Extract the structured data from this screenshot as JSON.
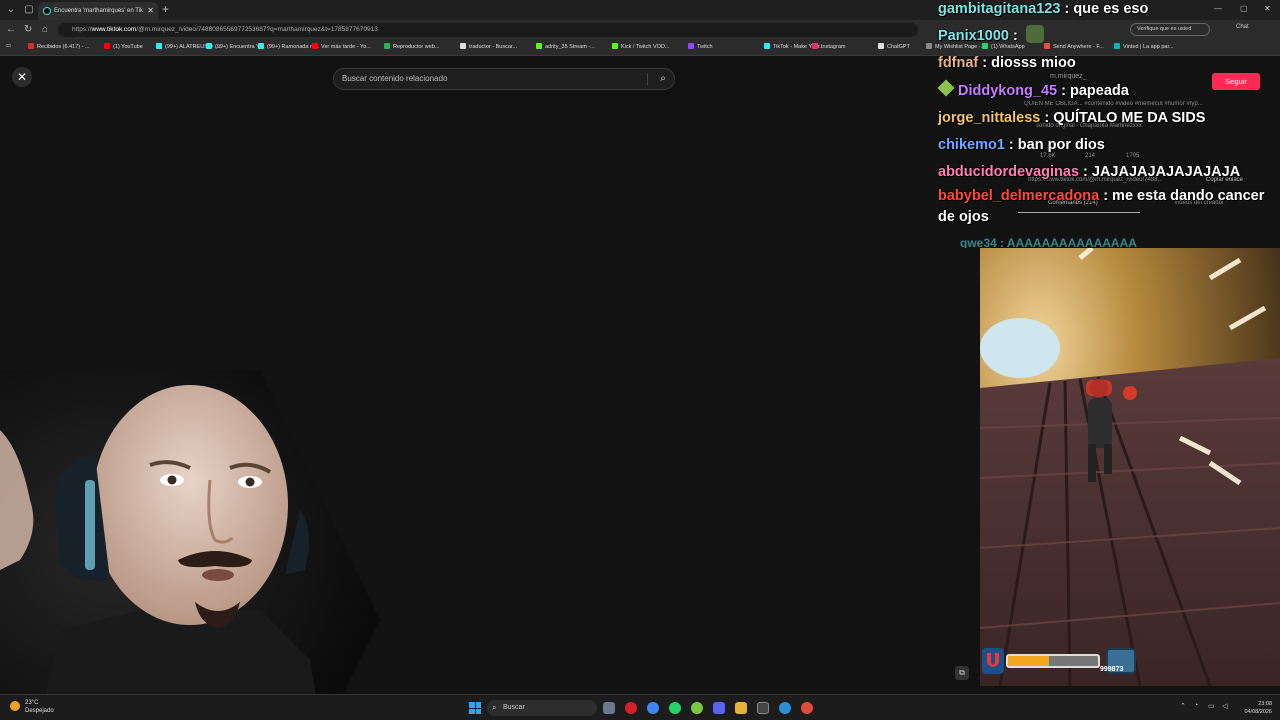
{
  "browser": {
    "tab_title": "Encuentra 'marthamirques' en Tik",
    "url_prefix": "https://",
    "url_host": "www.tiktok.com",
    "url_path": "/@m.mirquez_/video/7488086556977253687?q=marthamirquez&t=1785877670913",
    "verify_label": "Verifique que es usted",
    "chat_label": "Chat",
    "bookmarks": [
      {
        "label": "Recibidos (6.417) - ...",
        "color": "#d93025"
      },
      {
        "label": "(1) YouTube",
        "color": "#ff0000"
      },
      {
        "label": "(99+) ALATREUS ✦ ...",
        "color": "#25f4ee"
      },
      {
        "label": "(99+) Encuentra 'vi...",
        "color": "#25f4ee"
      },
      {
        "label": "(99+) Ramonada ro...",
        "color": "#25f4ee"
      },
      {
        "label": "Ver más tarde - Yo...",
        "color": "#ff0000"
      },
      {
        "label": "Reproductor web...",
        "color": "#1db954"
      },
      {
        "label": "traductor - Buscar...",
        "color": "#dddddd"
      },
      {
        "label": "adrity_35 Stream -...",
        "color": "#53fc18"
      },
      {
        "label": "Kick / Twitch VOD...",
        "color": "#53fc18"
      },
      {
        "label": "Twitch",
        "color": "#9146ff"
      },
      {
        "label": "TikTok - Make Your...",
        "color": "#25f4ee"
      },
      {
        "label": "Instagram",
        "color": "#e1306c"
      },
      {
        "label": "ChatGPT",
        "color": "#dddddd"
      },
      {
        "label": "My Wishlist Page -...",
        "color": "#888888"
      },
      {
        "label": "(1) WhatsApp",
        "color": "#25d366"
      },
      {
        "label": "Send Anywhere - F...",
        "color": "#e74c3c"
      },
      {
        "label": "Vinted | La app par...",
        "color": "#09b1ba"
      }
    ]
  },
  "tiktok": {
    "search_placeholder": "Buscar contenido relacionado",
    "author": "m.mirquez_",
    "follow_label": "Seguir",
    "caption": "QUIEN ME OBLIGA... #contenido #video #memecut #humor #fyp...",
    "sound": "sonido original - Chaparrita Martinezxxx",
    "likes": "17.6K",
    "comments_count": "214",
    "saves": "1705",
    "video_link": "https://www.tiktok.com/@m.mirquez_/video/7488...",
    "copy_link": "Copiar enlace",
    "tab_comments": "Comentarios (214)",
    "tab_creator": "Videos del creador"
  },
  "chat": [
    {
      "user": "gambitagitana123",
      "color": "#7fe3e3",
      "text": " : que es eso"
    },
    {
      "user": "Panix1000",
      "color": "#7fe3e3",
      "text": " : ",
      "emote": true
    },
    {
      "user": "fdfnaf",
      "color": "#e9b48a",
      "text": " : diosss mioo"
    },
    {
      "user": "Diddykong_45",
      "color": "#c77dff",
      "text": " : papeada",
      "badge": true
    },
    {
      "user": "jorge_nittaless",
      "color": "#f3c46b",
      "text": " : QUÍTALO ME DA SIDS"
    },
    {
      "user": "chikemo1",
      "color": "#6fa8ff",
      "text": " : ban por dios"
    },
    {
      "user": "abducidordevaginas",
      "color": "#ff7fb0",
      "text": " : JAJAJAJAJAJAJAJA"
    },
    {
      "user": "babybel_delmercadona",
      "color": "#ff4a3a",
      "text": " : me esta dando cancer de ojos"
    }
  ],
  "chat_partial": "qwe34 : AAAAAAAAAAAAAAA",
  "game": {
    "powerup_level": 0.45,
    "score": "999873"
  },
  "taskbar": {
    "temp": "23°C",
    "weather": "Despejado",
    "search_label": "Buscar",
    "time": "23:08",
    "date": "04/08/2026"
  }
}
